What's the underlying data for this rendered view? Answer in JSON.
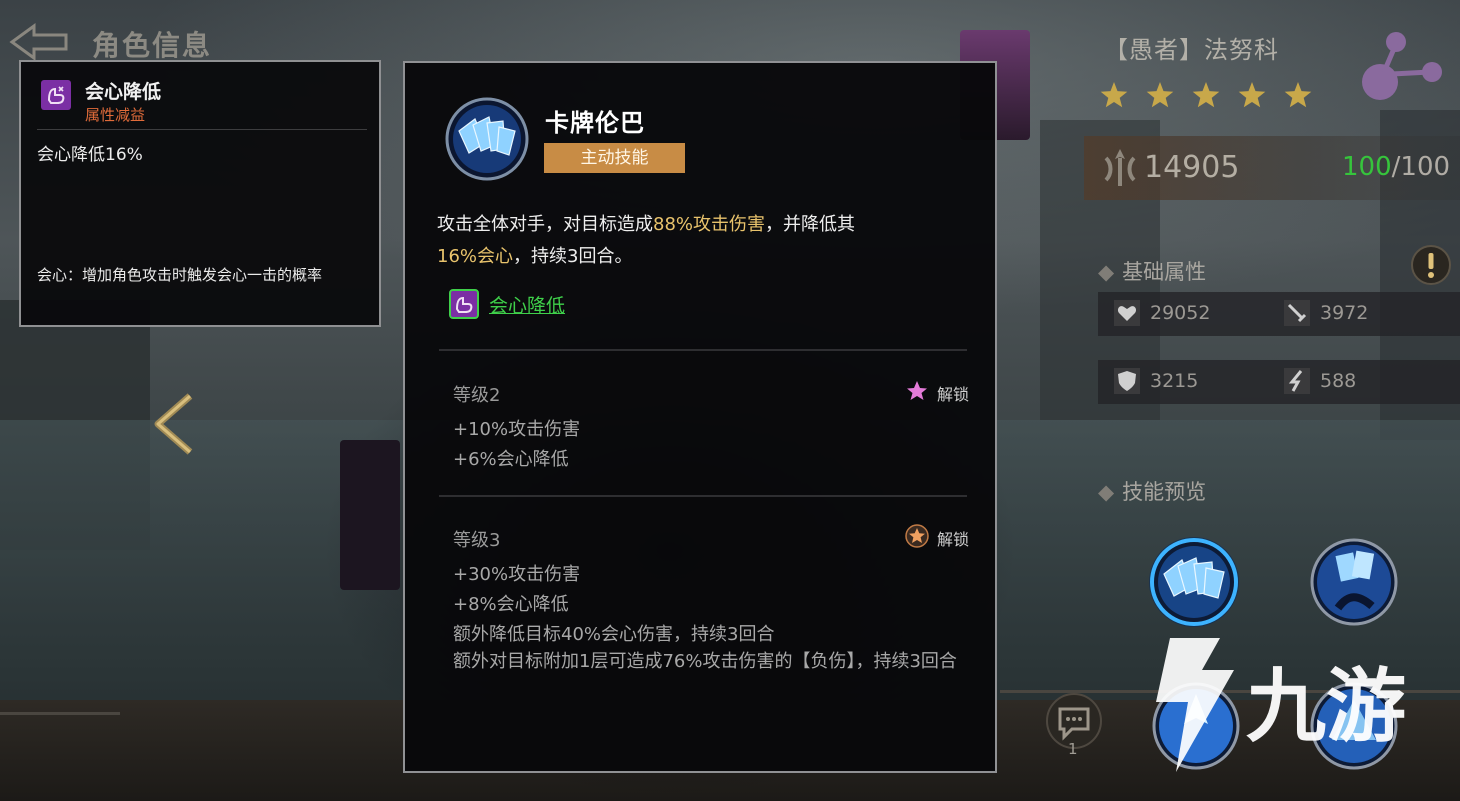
{
  "header": {
    "title": "角色信息"
  },
  "buff_tooltip": {
    "name": "会心降低",
    "type": "属性减益",
    "value": "会心降低16%",
    "description": "会心：增加角色攻击时触发会心一击的概率",
    "icon": "fist-down-icon"
  },
  "skill_tooltip": {
    "name": "卡牌伦巴",
    "tag": "主动技能",
    "desc_part1": "攻击全体对手，对目标造成",
    "desc_hl1": "88%攻击伤害",
    "desc_part2": "，并降低其",
    "desc_hl2": "16%会心",
    "desc_part3": "，持续3回合。",
    "effect_name": "会心降低",
    "levels": [
      {
        "title": "等级2",
        "unlock": "解锁",
        "lines": [
          "+10%攻击伤害",
          "+6%会心降低"
        ]
      },
      {
        "title": "等级3",
        "unlock": "解锁",
        "lines": [
          "+30%攻击伤害",
          "+8%会心降低",
          "额外降低目标40%会心伤害，持续3回合",
          "额外对目标附加1层可造成76%攻击伤害的【负伤】，持续3回合"
        ]
      }
    ]
  },
  "hero": {
    "name": "【愚者】法努科",
    "star_count": 5,
    "power": "14905",
    "stamina_current": "100",
    "stamina_max": "/100"
  },
  "sections": {
    "base_attributes": "基础属性",
    "skill_preview": "技能预览"
  },
  "stats": [
    {
      "icon": "heart-icon",
      "value": "29052"
    },
    {
      "icon": "sword-icon",
      "value": "3972"
    },
    {
      "icon": "shield-icon",
      "value": "3215"
    },
    {
      "icon": "speed-icon",
      "value": "588"
    }
  ],
  "chat": {
    "count": "1"
  },
  "watermark": "九游",
  "colors": {
    "highlight": "#e8c36c",
    "effect_green": "#3fd04a",
    "tag_bg": "#c88c45",
    "debuff_orange": "#e06b3a"
  }
}
